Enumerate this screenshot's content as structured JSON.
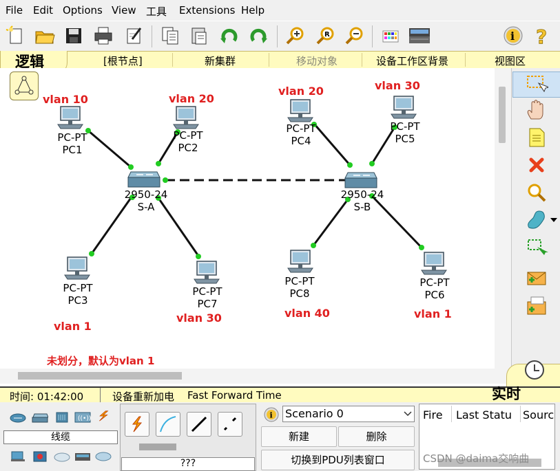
{
  "menu": [
    "File",
    "Edit",
    "Options",
    "View",
    "工具",
    "Extensions",
    "Help"
  ],
  "logic_bar": {
    "mode": "逻辑",
    "root": "[根节点]",
    "new_cluster": "新集群",
    "move_object": "移动对象",
    "background": "设备工作区背景",
    "viewport": "视图区"
  },
  "devices": {
    "pc1": {
      "type": "PC-PT",
      "name": "PC1"
    },
    "pc2": {
      "type": "PC-PT",
      "name": "PC2"
    },
    "pc3": {
      "type": "PC-PT",
      "name": "PC3"
    },
    "pc4": {
      "type": "PC-PT",
      "name": "PC4"
    },
    "pc5": {
      "type": "PC-PT",
      "name": "PC5"
    },
    "pc6": {
      "type": "PC-PT",
      "name": "PC6"
    },
    "pc7": {
      "type": "PC-PT",
      "name": "PC7"
    },
    "pc8": {
      "type": "PC-PT",
      "name": "PC8"
    },
    "swa": {
      "type": "2950-24",
      "name": "S-A"
    },
    "swb": {
      "type": "2950-24",
      "name": "S-B"
    }
  },
  "vlans": {
    "pc1": "vlan 10",
    "pc2": "vlan 20",
    "pc3": "vlan 1",
    "pc4": "vlan 20",
    "pc5": "vlan 30",
    "pc6": "vlan 1",
    "pc7": "vlan 30",
    "pc8": "vlan 40"
  },
  "note": "未划分，默认为vlan 1",
  "status": {
    "time_label": "时间: 01:42:00",
    "power_cycle": "设备重新加电",
    "fast_forward": "Fast Forward Time",
    "realtime": "实时"
  },
  "bottom": {
    "category_label": "线缆",
    "connection_desc": "???",
    "scenario": "Scenario 0",
    "new_button": "新建",
    "delete_button": "删除",
    "pdu_toggle": "切换到PDU列表窗口",
    "table_headers": [
      "Fire",
      "Last Statu",
      "Sourc"
    ],
    "watermark": "CSDN @daima交响曲"
  },
  "colors": {
    "accent_yellow": "#fffbbf",
    "vlan_red": "#e02020",
    "link_green": "#22cc22"
  }
}
